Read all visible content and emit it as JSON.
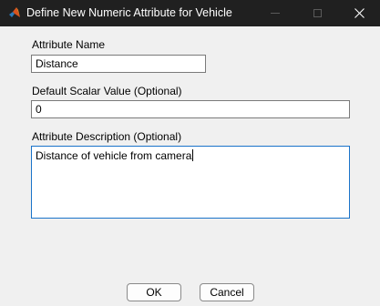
{
  "window": {
    "title": "Define New Numeric Attribute for Vehicle",
    "app_icon": "matlab-icon"
  },
  "form": {
    "name_label": "Attribute Name",
    "name_value": "Distance",
    "default_label": "Default Scalar Value (Optional)",
    "default_value": "0",
    "description_label": "Attribute Description (Optional)",
    "description_value": "Distance of vehicle from camera"
  },
  "buttons": {
    "ok_label": "OK",
    "cancel_label": "Cancel"
  },
  "colors": {
    "titlebar": "#202020",
    "dialog_background": "#f0f0f0",
    "focus_border": "#1a73c9"
  }
}
